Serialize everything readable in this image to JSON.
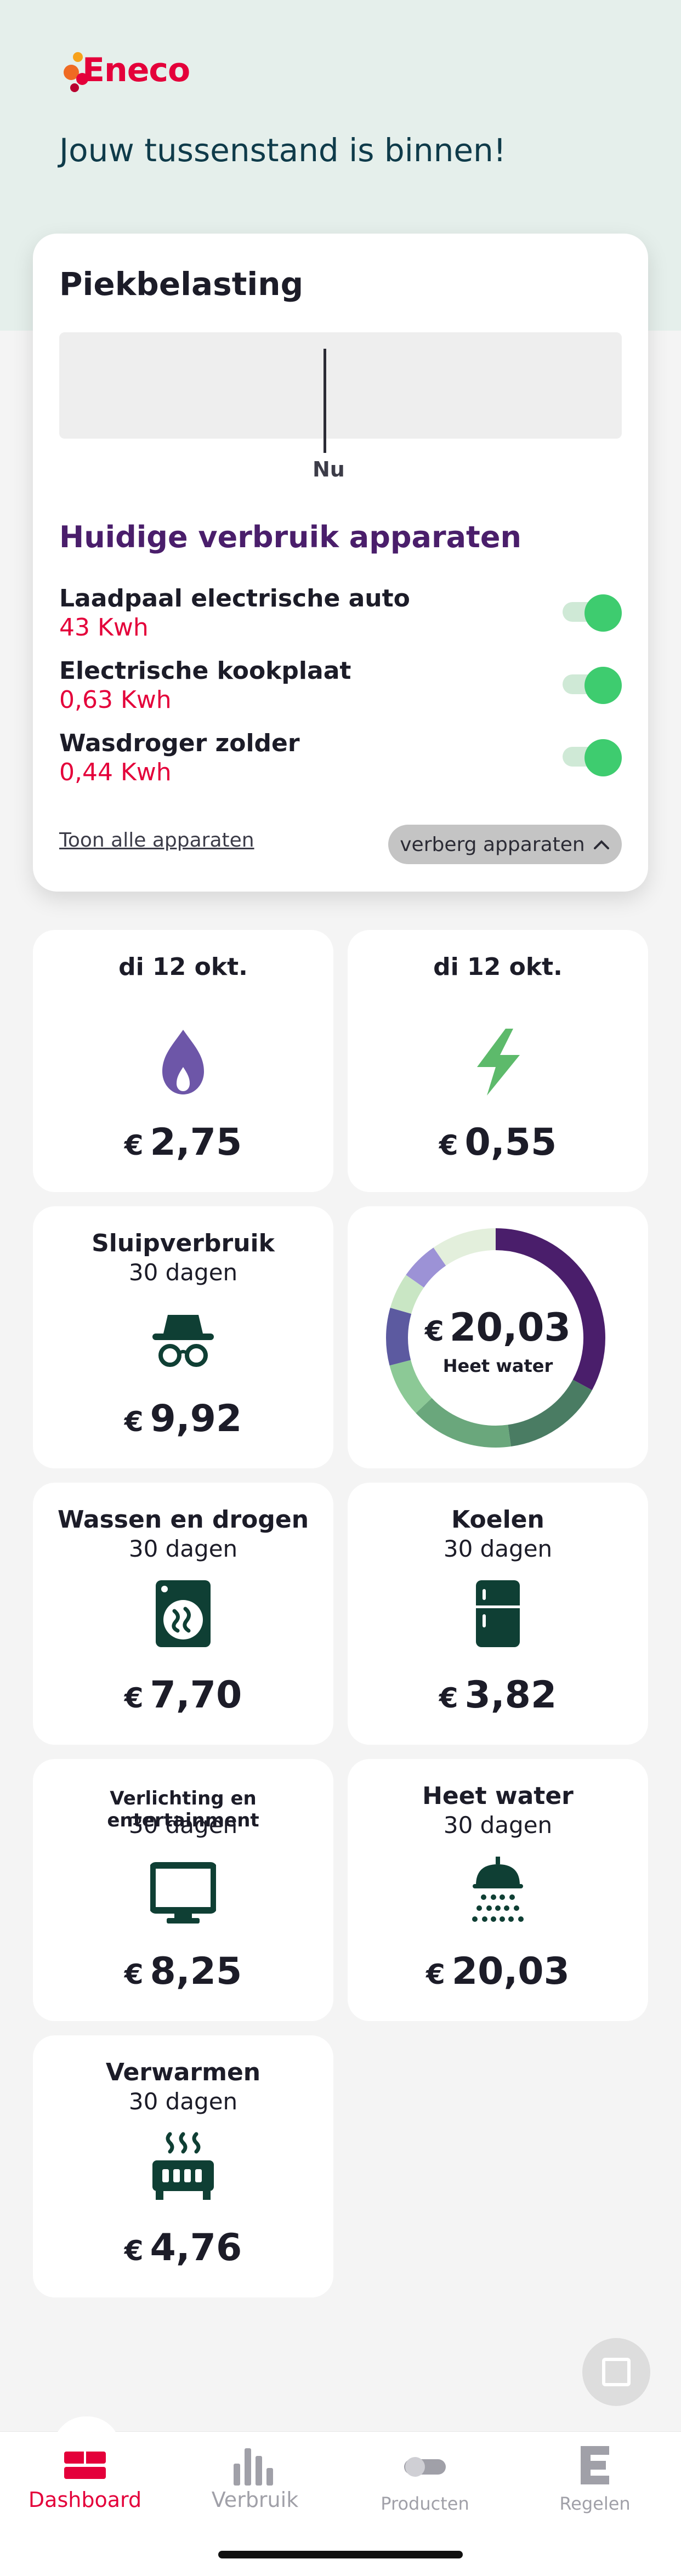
{
  "app": {
    "brand": "Eneco",
    "headline": "Jouw tussenstand is binnen!"
  },
  "peak_card": {
    "title": "Piekbelasting",
    "now_label": "Nu",
    "devices_title": "Huidige verbruik apparaten",
    "devices": [
      {
        "name": "Laadpaal electrische auto",
        "value": "43 Kwh",
        "enabled": true
      },
      {
        "name": "Electrische kookplaat",
        "value": "0,63 Kwh",
        "enabled": true
      },
      {
        "name": "Wasdroger zolder",
        "value": "0,44 Kwh",
        "enabled": true
      }
    ],
    "show_all_link": "Toon alle apparaten",
    "hide_button": "verberg apparaten"
  },
  "tiles": {
    "gas": {
      "title": "di 12 okt.",
      "currency": "€",
      "amount": "2,75",
      "icon": "flame-icon"
    },
    "power": {
      "title": "di 12 okt.",
      "currency": "€",
      "amount": "0,55",
      "icon": "lightning-icon"
    },
    "standby": {
      "title": "Sluipverbruik",
      "subtitle": "30 dagen",
      "currency": "€",
      "amount": "9,92",
      "icon": "spy-icon"
    },
    "donut": {
      "currency": "€",
      "amount": "20,03",
      "label": "Heet water"
    },
    "washing": {
      "title": "Wassen en drogen",
      "subtitle": "30 dagen",
      "currency": "€",
      "amount": "7,70",
      "icon": "washing-machine-icon"
    },
    "cooling": {
      "title": "Koelen",
      "subtitle": "30 dagen",
      "currency": "€",
      "amount": "3,82",
      "icon": "fridge-icon"
    },
    "lighting": {
      "title": "Verlichting en entertainment",
      "subtitle": "30 dagen",
      "currency": "€",
      "amount": "8,25",
      "icon": "monitor-icon"
    },
    "hotwater": {
      "title": "Heet water",
      "subtitle": "30 dagen",
      "currency": "€",
      "amount": "20,03",
      "icon": "shower-icon"
    },
    "heating": {
      "title": "Verwarmen",
      "subtitle": "30 dagen",
      "currency": "€",
      "amount": "4,76",
      "icon": "radiator-icon"
    }
  },
  "nav": [
    {
      "label": "Dashboard",
      "icon": "dashboard-icon",
      "active": true
    },
    {
      "label": "Verbruik",
      "icon": "bar-chart-icon",
      "active": false
    },
    {
      "label": "Producten",
      "icon": "toggle-icon",
      "active": false
    },
    {
      "label": "Regelen",
      "icon": "eneco-e-icon",
      "active": false
    }
  ],
  "colors": {
    "brand_red": "#e4003a",
    "purple": "#4a1e6b",
    "dark_green": "#0f3f34",
    "toggle_green": "#3ecc6f"
  }
}
